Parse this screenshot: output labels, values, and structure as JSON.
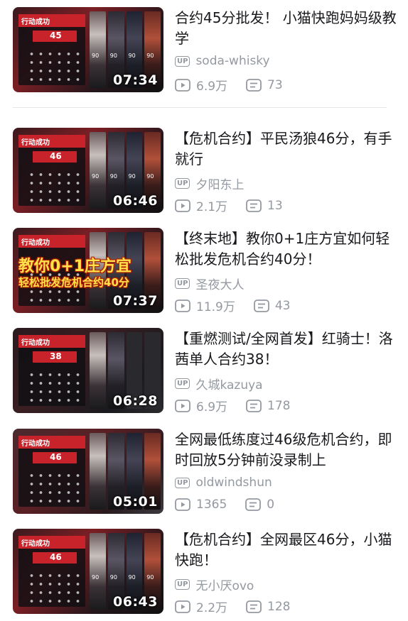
{
  "videos": [
    {
      "title": "合约45分批发！ 小猫快跑妈妈级教学",
      "uploader": "soda-whisky",
      "views": "6.9万",
      "comments": "73",
      "duration": "07:34",
      "thumb_header": "行动成功",
      "thumb_score": "45",
      "thumb_overlay_1": "",
      "thumb_overlay_2": ""
    },
    {
      "title": "【危机合约】平民汤狼46分，有手就行",
      "uploader": "夕阳东上",
      "views": "2.1万",
      "comments": "13",
      "duration": "06:46",
      "thumb_header": "行动成功",
      "thumb_score": "46",
      "thumb_overlay_1": "",
      "thumb_overlay_2": ""
    },
    {
      "title": "【终末地】教你0+1庄方宜如何轻松批发危机合约40分！",
      "uploader": "圣夜大人",
      "views": "11.9万",
      "comments": "43",
      "duration": "07:37",
      "thumb_header": "行动成功",
      "thumb_score": "",
      "thumb_overlay_1": "教你0+1庄方宜",
      "thumb_overlay_2": "轻松批发危机合约40分"
    },
    {
      "title": "【重燃测试/全网首发】红骑士！洛茜单人合约38！",
      "uploader": "久城kazuya",
      "views": "6.9万",
      "comments": "178",
      "duration": "06:28",
      "thumb_header": "行动成功",
      "thumb_score": "38",
      "thumb_overlay_1": "",
      "thumb_overlay_2": ""
    },
    {
      "title": "全网最低练度过46级危机合约，即时回放5分钟前没录制上",
      "uploader": "oldwindshun",
      "views": "1365",
      "comments": "0",
      "duration": "05:01",
      "thumb_header": "行动成功",
      "thumb_score": "46",
      "thumb_overlay_1": "",
      "thumb_overlay_2": ""
    },
    {
      "title": "【危机合约】全网最区46分，小猫快跑！",
      "uploader": "无小厌ovo",
      "views": "2.2万",
      "comments": "128",
      "duration": "06:43",
      "thumb_header": "行动成功",
      "thumb_score": "46",
      "thumb_overlay_1": "",
      "thumb_overlay_2": ""
    }
  ],
  "up_badge": "UP",
  "char_level": "90",
  "icons": {
    "play": "play-count-icon",
    "comment": "comment-count-icon",
    "up": "uploader-badge-icon"
  },
  "colors": {
    "text": "#18191c",
    "meta": "#9499a0",
    "thumb_accent": "#c8232b",
    "overlay": "#ffe14a"
  }
}
